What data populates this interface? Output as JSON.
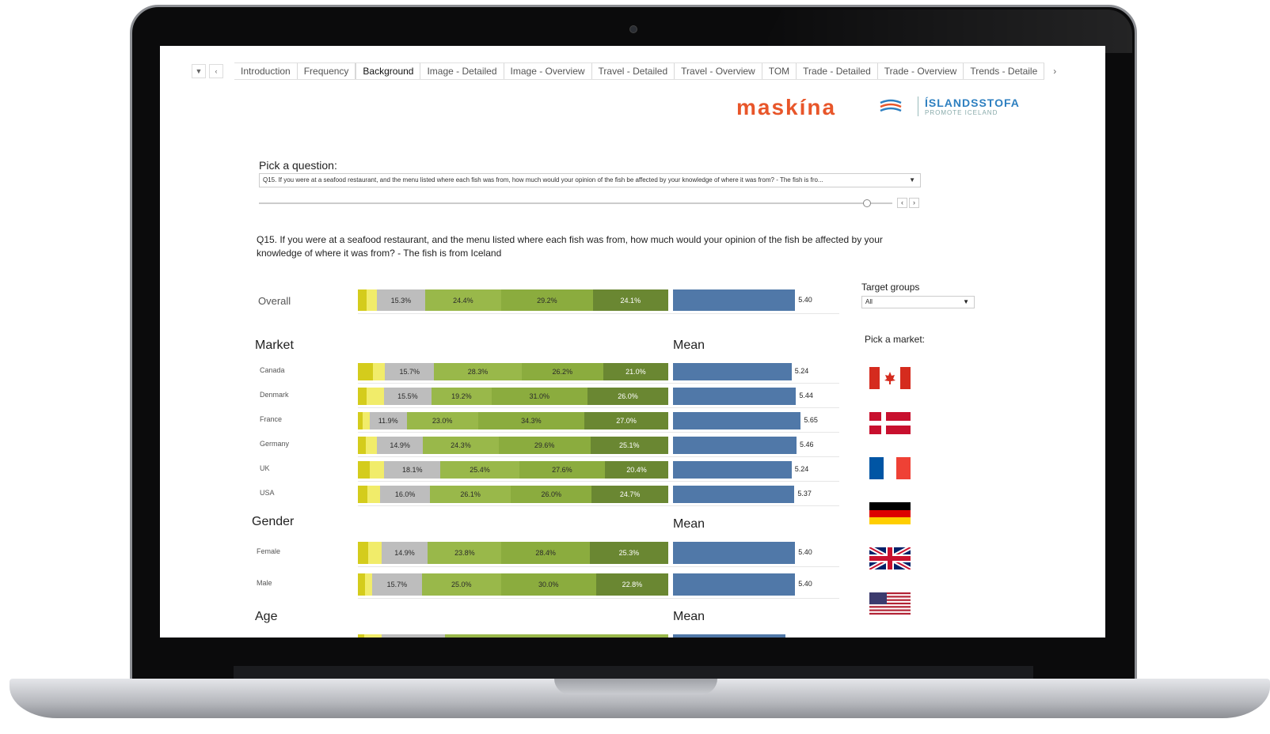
{
  "tabs": [
    "Introduction",
    "Frequency",
    "Background",
    "Image - Detailed",
    "Image - Overview",
    "Travel - Detailed",
    "Travel - Overview",
    "TOM",
    "Trade - Detailed",
    "Trade - Overview",
    "Trends - Detaile"
  ],
  "active_tab": "Background",
  "logos": {
    "maskina": "maskína",
    "islandsstofa": "ÍSLANDSSTOFA",
    "promote": "PROMOTE ICELAND"
  },
  "question_picker": {
    "label": "Pick a question:",
    "selected": "Q15. If you were at a seafood restaurant, and the menu listed where each fish was from, how much would your opinion of the fish be affected by your knowledge of where it was from? - The fish is fro..."
  },
  "question_title": "Q15. If you were at a seafood restaurant, and the menu listed where each fish was from, how much would your opinion of the fish be affected by your knowledge of where it was from? - The fish is from Iceland",
  "target_groups": {
    "label": "Target groups",
    "selected": "All"
  },
  "pick_market_label": "Pick a market:",
  "markets": [
    "canada-flag",
    "denmark-flag",
    "france-flag",
    "germany-flag",
    "uk-flag",
    "usa-flag"
  ],
  "colors": {
    "dark_yellow": "#d4cc1c",
    "yellow": "#f1ec6a",
    "gray": "#bdbdbd",
    "light_green": "#99b84a",
    "green": "#8bac3e",
    "dark_green": "#6a8732",
    "mean": "#5078a8"
  },
  "chart_data": {
    "type": "bar",
    "stacked": true,
    "section_headings": {
      "market": "Market",
      "gender": "Gender",
      "age": "Age",
      "mean": "Mean"
    },
    "overall": {
      "label": "Overall",
      "segments": [
        2.7,
        3.4,
        15.3,
        24.4,
        29.2,
        24.1
      ],
      "mean": "5.40"
    },
    "market": [
      {
        "label": "Canada",
        "segments": [
          4.8,
          4.0,
          15.7,
          28.3,
          26.2,
          21.0
        ],
        "mean": "5.24"
      },
      {
        "label": "Denmark",
        "segments": [
          2.8,
          5.5,
          15.5,
          19.2,
          31.0,
          26.0
        ],
        "mean": "5.44"
      },
      {
        "label": "France",
        "segments": [
          1.5,
          2.3,
          11.9,
          23.0,
          34.3,
          27.0
        ],
        "mean": "5.65"
      },
      {
        "label": "Germany",
        "segments": [
          2.6,
          3.5,
          14.9,
          24.3,
          29.6,
          25.1
        ],
        "mean": "5.46"
      },
      {
        "label": "UK",
        "segments": [
          3.9,
          4.6,
          18.1,
          25.4,
          27.6,
          20.4
        ],
        "mean": "5.24"
      },
      {
        "label": "USA",
        "segments": [
          3.0,
          4.2,
          16.0,
          26.1,
          26.0,
          24.7
        ],
        "mean": "5.37"
      }
    ],
    "gender": [
      {
        "label": "Female",
        "segments": [
          3.4,
          4.2,
          14.9,
          23.8,
          28.4,
          25.3
        ],
        "mean": "5.40"
      },
      {
        "label": "Male",
        "segments": [
          2.2,
          2.3,
          15.7,
          25.0,
          30.0,
          22.8
        ],
        "mean": "5.40"
      }
    ],
    "mean_scale": [
      0,
      7
    ]
  }
}
